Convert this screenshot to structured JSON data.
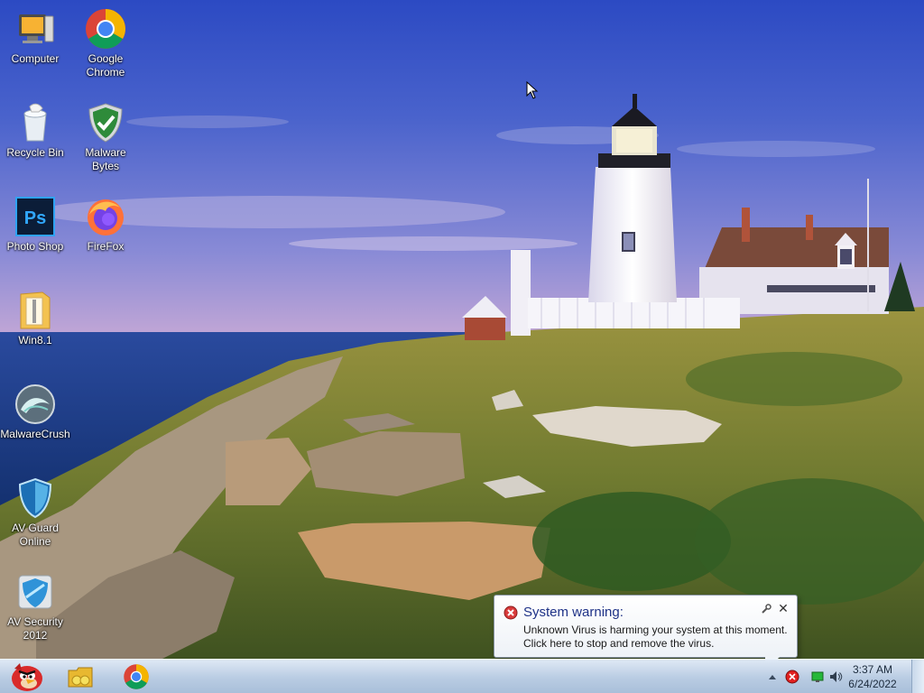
{
  "desktop": {
    "icons": [
      {
        "label": "Computer",
        "icon": "computer-icon"
      },
      {
        "label": "Google Chrome",
        "icon": "chrome-icon"
      },
      {
        "label": "Recycle Bin",
        "icon": "recycle-bin-icon"
      },
      {
        "label": "Malware Bytes",
        "icon": "shield-check-icon"
      },
      {
        "label": "Photo Shop",
        "icon": "photoshop-icon"
      },
      {
        "label": "FireFox",
        "icon": "firefox-icon"
      },
      {
        "label": "Win8.1",
        "icon": "zip-folder-icon"
      },
      {
        "label": "MalwareCrush",
        "icon": "malwarecrush-icon"
      },
      {
        "label": "AV Guard Online",
        "icon": "shield-icon"
      },
      {
        "label": "AV Security 2012",
        "icon": "av-security-icon"
      }
    ]
  },
  "taskbar": {
    "pinned": [
      {
        "icon": "angry-bird-start-icon"
      },
      {
        "icon": "folder-icon"
      },
      {
        "icon": "chrome-icon"
      }
    ],
    "clock": {
      "time": "3:37 AM",
      "date": "6/24/2022"
    },
    "tray_icons": [
      "show-hidden-icon",
      "security-alert-icon",
      "network-icon",
      "volume-icon"
    ]
  },
  "notification": {
    "title": "System warning:",
    "message": "Unknown Virus is harming your system at this moment. Click here to stop and remove the virus.",
    "close_label": "✕"
  },
  "colors": {
    "sky_top": "#2f4fc4",
    "sky_bottom": "#a7a6dc",
    "sea": "#1c3f8a",
    "grass": "#8a8d3a",
    "taskbar": "#bfd0e5",
    "balloon_title": "#1e3287"
  }
}
